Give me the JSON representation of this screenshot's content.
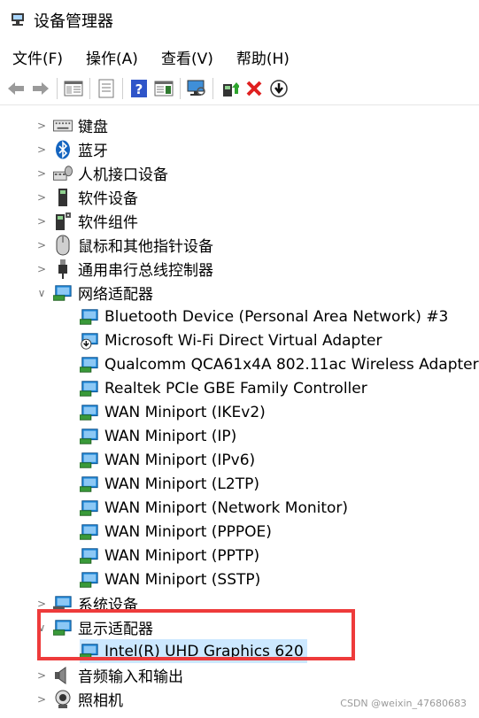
{
  "window": {
    "title": "设备管理器"
  },
  "menu": [
    "文件(F)",
    "操作(A)",
    "查看(V)",
    "帮助(H)"
  ],
  "toolbar": [
    {
      "name": "back-icon"
    },
    {
      "name": "forward-icon"
    },
    {
      "name": "show-hide-console-tree-icon"
    },
    {
      "name": "properties-icon"
    },
    {
      "name": "help-icon"
    },
    {
      "name": "view-icon"
    },
    {
      "name": "scan-hardware-icon"
    },
    {
      "name": "update-driver-icon"
    },
    {
      "name": "uninstall-icon"
    },
    {
      "name": "disable-icon"
    }
  ],
  "tree": {
    "categories_top": [
      {
        "label": "键盘",
        "icon": "keyboard-icon"
      },
      {
        "label": "蓝牙",
        "icon": "bluetooth-icon"
      },
      {
        "label": "人机接口设备",
        "icon": "hid-icon"
      },
      {
        "label": "软件设备",
        "icon": "software-device-icon"
      },
      {
        "label": "软件组件",
        "icon": "software-component-icon"
      },
      {
        "label": "鼠标和其他指针设备",
        "icon": "mouse-icon"
      },
      {
        "label": "通用串行总线控制器",
        "icon": "usb-icon"
      }
    ],
    "network": {
      "label": "网络适配器",
      "children": [
        "Bluetooth Device (Personal Area Network) #3",
        "Microsoft Wi-Fi Direct Virtual Adapter",
        "Qualcomm QCA61x4A 802.11ac Wireless Adapter",
        "Realtek PCIe GBE Family Controller",
        "WAN Miniport (IKEv2)",
        "WAN Miniport (IP)",
        "WAN Miniport (IPv6)",
        "WAN Miniport (L2TP)",
        "WAN Miniport (Network Monitor)",
        "WAN Miniport (PPPOE)",
        "WAN Miniport (PPTP)",
        "WAN Miniport (SSTP)"
      ]
    },
    "system": {
      "label": "系统设备"
    },
    "display": {
      "label": "显示适配器",
      "children": [
        "Intel(R) UHD Graphics 620"
      ]
    },
    "categories_bottom": [
      {
        "label": "音频输入和输出",
        "icon": "audio-icon"
      },
      {
        "label": "照相机",
        "icon": "camera-icon"
      }
    ]
  },
  "watermark": "CSDN @weixin_47680683",
  "colors": {
    "selection": "#cce8ff",
    "highlight_box": "#ee3b3b",
    "network_icon": "#1e88d8"
  }
}
